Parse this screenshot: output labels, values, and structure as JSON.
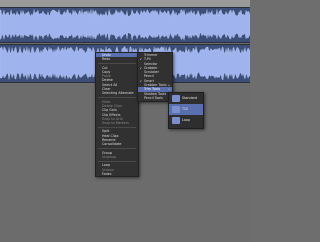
{
  "colors": {
    "track_bg": "#3d4f78",
    "waveform": "#9fb4ee",
    "menu_bg": "#313131",
    "highlight": "#5a6fb0",
    "arrange_bg": "#6c6c6c"
  },
  "context_menu": {
    "items": [
      {
        "label": "Undo",
        "dim": false
      },
      {
        "label": "Redo",
        "dim": false
      },
      {
        "label": "Cut",
        "dim": false
      },
      {
        "label": "Copy",
        "dim": false
      },
      {
        "label": "Paste",
        "dim": true
      },
      {
        "label": "Delete",
        "dim": false
      },
      {
        "label": "Select All",
        "dim": false
      },
      {
        "label": "Clear",
        "dim": false
      },
      {
        "label": "Selecting Alternate",
        "dim": false
      },
      {
        "label": "Mute",
        "dim": true
      },
      {
        "label": "Delete Clips",
        "dim": true
      },
      {
        "label": "Clip Gain",
        "dim": false
      },
      {
        "label": "Clip Effects",
        "dim": false
      },
      {
        "label": "Snap to Grid",
        "dim": true
      },
      {
        "label": "Snap to Markers",
        "dim": true
      },
      {
        "label": "Split",
        "dim": false
      },
      {
        "label": "Heal Clips",
        "dim": false
      },
      {
        "label": "Rename",
        "dim": false
      },
      {
        "label": "Consolidate",
        "dim": false
      },
      {
        "label": "Group",
        "dim": false
      },
      {
        "label": "Ungroup",
        "dim": true
      },
      {
        "label": "Loop",
        "dim": false
      },
      {
        "label": "Unloop",
        "dim": true
      },
      {
        "label": "Fades",
        "dim": false
      }
    ]
  },
  "submenu_1": {
    "items": [
      {
        "label": "Trimmer",
        "checked": false
      },
      {
        "label": "T-Fit",
        "checked": true
      },
      {
        "label": "Selector",
        "checked": false
      },
      {
        "label": "Grabber",
        "checked": true
      },
      {
        "label": "Scrubber",
        "checked": false
      },
      {
        "label": "Pencil",
        "checked": false
      },
      {
        "label": "Smart",
        "checked": true
      },
      {
        "label": "Grabber Tools",
        "checked": false
      },
      {
        "label": "Trim Tools",
        "checked": false
      },
      {
        "label": "Shadow Tools",
        "checked": false
      },
      {
        "label": "Pencil Tools",
        "checked": false
      }
    ]
  },
  "tool_panel": {
    "tools": [
      {
        "label": "Standard"
      },
      {
        "label": "TCE"
      },
      {
        "label": "Loop"
      }
    ]
  }
}
